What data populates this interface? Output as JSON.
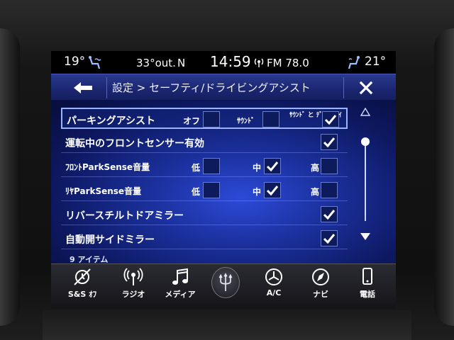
{
  "status": {
    "seat_temp_left": "19°",
    "outside_temp": "33°out.",
    "compass": "N",
    "time": "14:59",
    "radio": "FM 78.0",
    "seat_temp_right": "21°"
  },
  "header": {
    "title": "設定 > セーフティ/ドライビングアシスト"
  },
  "rows": [
    {
      "label": "パーキングアシスト",
      "options": [
        {
          "label": "オフ",
          "checked": false
        },
        {
          "label": "ｻｳﾝﾄﾞ",
          "checked": false
        },
        {
          "label": "ｻｳﾝﾄﾞ と ﾃﾞｨｽﾌﾟﾚｲ",
          "checked": true
        }
      ]
    },
    {
      "label": "運転中のフロントセンサー有効",
      "checked": true
    },
    {
      "label": "ﾌﾛﾝﾄParkSense音量",
      "options": [
        {
          "label": "低",
          "checked": false
        },
        {
          "label": "中",
          "checked": true
        },
        {
          "label": "高",
          "checked": false
        }
      ]
    },
    {
      "label": "ﾘﾔParkSense音量",
      "options": [
        {
          "label": "低",
          "checked": false
        },
        {
          "label": "中",
          "checked": true
        },
        {
          "label": "高",
          "checked": false
        }
      ]
    },
    {
      "label": "リバースチルトドアミラー",
      "checked": true
    },
    {
      "label": "自動開サイドミラー",
      "checked": true
    }
  ],
  "item_count": "9 アイテム",
  "nav": {
    "ss_off": "S&S ｵﾌ",
    "radio": "ラジオ",
    "media": "メディア",
    "ac": "A/C",
    "navi": "ナビ",
    "phone": "電話"
  },
  "colors": {
    "accent_blue": "#1b2670",
    "check": "#ffffff"
  }
}
